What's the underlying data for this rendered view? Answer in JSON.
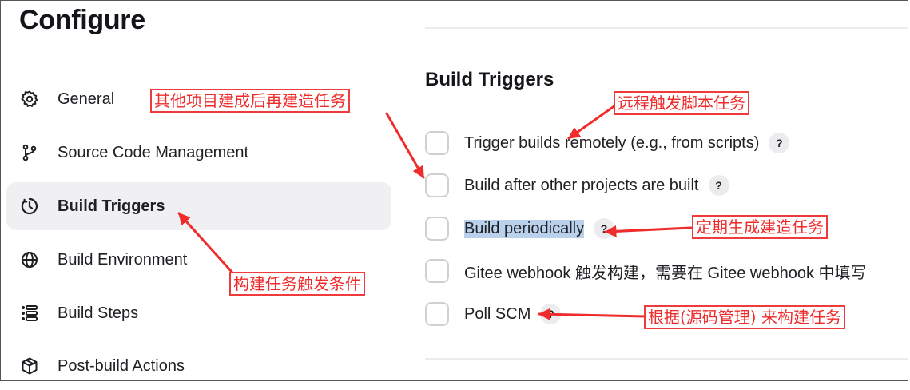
{
  "page": {
    "title": "Configure"
  },
  "sidebar": {
    "items": [
      {
        "label": "General",
        "icon": "gear-icon"
      },
      {
        "label": "Source Code Management",
        "icon": "branch-icon"
      },
      {
        "label": "Build Triggers",
        "icon": "clock-icon",
        "active": true
      },
      {
        "label": "Build Environment",
        "icon": "globe-icon"
      },
      {
        "label": "Build Steps",
        "icon": "list-icon"
      },
      {
        "label": "Post-build Actions",
        "icon": "package-icon"
      }
    ]
  },
  "section": {
    "title": "Build Triggers",
    "triggers": [
      {
        "label": "Trigger builds remotely (e.g., from scripts)",
        "help": "?"
      },
      {
        "label": "Build after other projects are built",
        "help": "?"
      },
      {
        "label": "Build periodically",
        "help": "?"
      },
      {
        "label": "Gitee webhook 触发构建，需要在 Gitee webhook 中填写"
      },
      {
        "label": "Poll SCM",
        "help": "?"
      }
    ]
  },
  "annotations": {
    "other_projects": "其他项目建成后再建造任务",
    "remote_script": "远程触发脚本任务",
    "periodic": "定期生成建造任务",
    "trigger_condition": "构建任务触发条件",
    "poll_scm": "根据(源码管理) 来构建任务",
    "color": "#ef2b2b"
  },
  "colors": {
    "active_sidebar_bg": "#f0f0f3",
    "highlight": "#b9d1ea",
    "checkbox_border": "#cfcfd4"
  }
}
